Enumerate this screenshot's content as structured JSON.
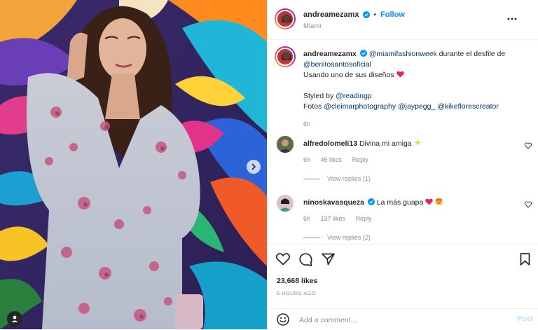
{
  "header": {
    "username": "andreamezamx",
    "verified_icon": "verified-badge-icon",
    "dot": "•",
    "follow_label": "Follow",
    "location": "Miami",
    "more_icon": "more-options-icon"
  },
  "caption": {
    "username": "andreamezamx",
    "mention1": "@miamifashionweek",
    "text1": " durante el desfile de ",
    "mention2": "@benitosantosoficial",
    "line2": "Usando uno de sus diseños ",
    "styled_prefix": "Styled by ",
    "styled_mention": "@readingp",
    "fotos_prefix": "Fotos ",
    "fotos_m1": "@cleimarphotography",
    "fotos_m2": "@jaypegg_",
    "fotos_m3": "@kikeflorescreator",
    "age": "6h"
  },
  "comments": [
    {
      "username": "alfredolomeli13",
      "text": "Divina mi amiga",
      "age": "6h",
      "likes": "45 likes",
      "reply": "Reply",
      "view_replies": "View replies (1)"
    },
    {
      "username": "ninoskavasqueza",
      "text": "La más guapa",
      "age": "6h",
      "likes": "137 likes",
      "reply": "Reply",
      "view_replies": "View replies (2)"
    }
  ],
  "actions": {
    "like_icon": "heart-icon",
    "comment_icon": "comment-icon",
    "share_icon": "share-icon",
    "save_icon": "bookmark-icon"
  },
  "likes_count": "23,668 likes",
  "timestamp": "6 HOURS AGO",
  "comment_box": {
    "placeholder": "Add a comment...",
    "emoji_icon": "emoji-icon",
    "post_label": "Post"
  },
  "colors": {
    "accent": "#0095f6",
    "link": "#00376b",
    "muted": "#8e8e8e",
    "like_red": "#ed4956"
  }
}
